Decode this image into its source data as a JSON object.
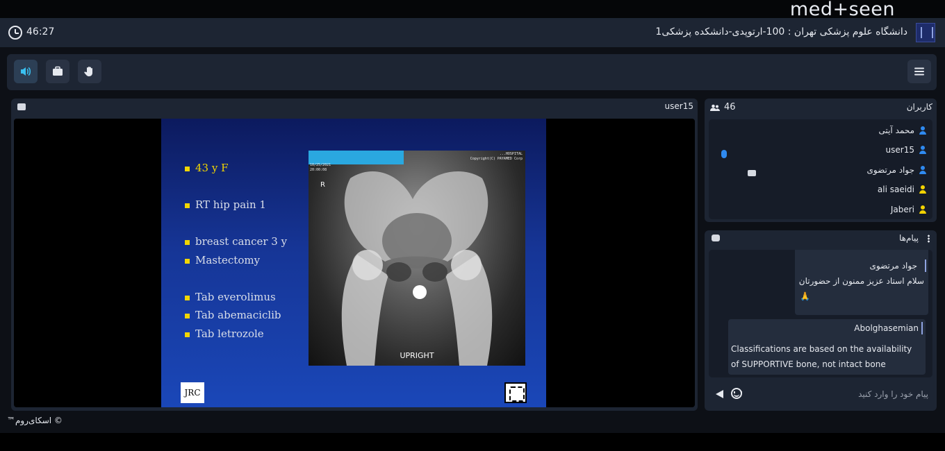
{
  "brand": {
    "name": "med+seen"
  },
  "header": {
    "timer": "46:27",
    "course_title": "دانشگاه علوم پزشکی تهران : 100-ارتوپدی-دانشکده پزشکی1"
  },
  "toolbar": {
    "buttons": [
      {
        "name": "speaker",
        "icon": "speaker-icon",
        "active": true
      },
      {
        "name": "briefcase",
        "icon": "briefcase-icon",
        "active": false
      },
      {
        "name": "raise-hand",
        "icon": "hand-icon",
        "active": false
      }
    ],
    "menu_icon": "hamburger-menu-icon"
  },
  "video": {
    "presenter": "user15",
    "slide": {
      "bullets": [
        "43 y F",
        "RT hip pain 1",
        "breast cancer 3 y",
        "Mastectomy",
        "Tab everolimus",
        "Tab abemaciclib",
        "Tab letrozole"
      ],
      "xray": {
        "orientation_marker": "R",
        "label": "UPRIGHT",
        "header_text": [
          "...HOSPITAL",
          "Copyright(C) PAYAMED Corp",
          "10/25/2021",
          "20:00:08"
        ]
      },
      "logo_left": "JRC"
    }
  },
  "users": {
    "title": "کاربران",
    "count": "46",
    "list": [
      {
        "name": "محمد آیتی",
        "role_color": "#2f8af0",
        "mic": true,
        "screen": false
      },
      {
        "name": "user15",
        "role_color": "#2f8af0",
        "mic": false,
        "screen": true
      },
      {
        "name": "جواد مرتضوی",
        "role_color": "#2f8af0",
        "mic": false,
        "screen": false
      },
      {
        "name": "ali saeidi",
        "role_color": "#f2d200",
        "mic": false,
        "screen": false
      },
      {
        "name": "Jaberi",
        "role_color": "#f2d200",
        "mic": false,
        "screen": false
      }
    ]
  },
  "chat": {
    "title": "پیام‌ها",
    "messages": [
      {
        "author": "جواد مرتضوی",
        "text": "سلام استاد عزیز ممنون از حضورتان",
        "emoji": "🙏"
      },
      {
        "author": "Abolghasemian",
        "text": "Classifications are based on the availability of SUPPORTIVE bone, not intact bone"
      }
    ],
    "input_placeholder": "پیام خود را وارد کنید"
  },
  "footer": {
    "text": "© اسکای‌روم™"
  },
  "colors": {
    "panel": "#1d2533",
    "inner": "#161c28",
    "accent_blue": "#2f8af0",
    "accent_yellow": "#f2d200",
    "active_icon": "#3ac0f0"
  }
}
